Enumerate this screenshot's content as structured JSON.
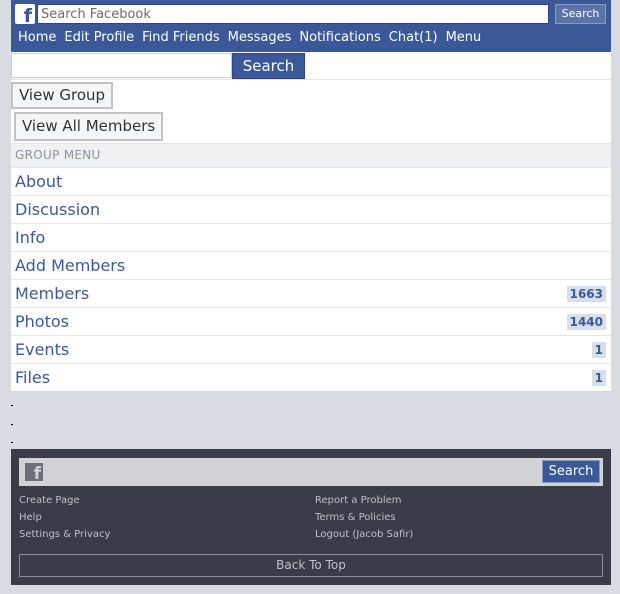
{
  "header": {
    "logo_glyph": "f",
    "search_placeholder": "Search Facebook",
    "search_button": "Search",
    "nav": [
      "Home",
      "Edit Profile",
      "Find Friends",
      "Messages",
      "Notifications",
      "Chat(1)",
      "Menu"
    ]
  },
  "search_bar": {
    "value": "",
    "button": "Search"
  },
  "buttons": {
    "view_group": "View Group",
    "view_all_members": "View All Members"
  },
  "group_menu": {
    "heading": "GROUP MENU",
    "items": [
      {
        "label": "About",
        "count": ""
      },
      {
        "label": "Discussion",
        "count": ""
      },
      {
        "label": "Info",
        "count": ""
      },
      {
        "label": "Add Members",
        "count": ""
      },
      {
        "label": "Members",
        "count": "1663"
      },
      {
        "label": "Photos",
        "count": "1440"
      },
      {
        "label": "Events",
        "count": "1"
      },
      {
        "label": "Files",
        "count": "1"
      }
    ]
  },
  "footer": {
    "logo_glyph": "f",
    "search_button": "Search",
    "links_left": [
      "Create Page",
      "Help",
      "Settings & Privacy"
    ],
    "links_right": [
      "Report a Problem",
      "Terms & Policies",
      "Logout (Jacob Safir)"
    ],
    "back_to_top": "Back To Top"
  },
  "colors": {
    "brand": "#3b5998",
    "footer_bg": "#3a3d47",
    "page_bg": "#d8dbe1"
  }
}
